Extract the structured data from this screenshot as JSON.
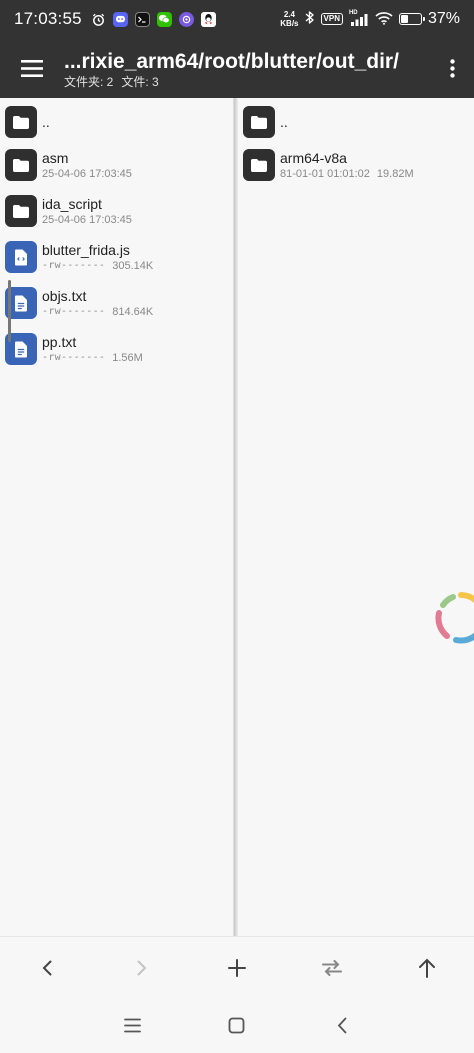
{
  "status_bar": {
    "time": "17:03:55",
    "notification_icons": [
      "alarm-icon",
      "discord-icon",
      "terminal-icon",
      "wechat-icon",
      "mastodon-icon",
      "qq-icon"
    ],
    "net_speed_value": "2.4",
    "net_speed_unit": "KB/s",
    "vpn_label": "VPN",
    "hd_label": "HD",
    "battery_percent_label": "37%",
    "battery_level": 0.37
  },
  "toolbar": {
    "path_title": "...rixie_arm64/root/blutter/out_dir/",
    "folder_count_label": "文件夹: 2",
    "file_count_label": "文件: 3"
  },
  "left_pane": {
    "parent_label": "..",
    "items": [
      {
        "type": "folder",
        "name": "asm",
        "perm": "",
        "size": "",
        "date": "25-04-06 17:03:45"
      },
      {
        "type": "folder",
        "name": "ida_script",
        "perm": "",
        "size": "",
        "date": "25-04-06 17:03:45"
      },
      {
        "type": "code-file",
        "name": "blutter_frida.js",
        "perm": "-rw-------",
        "size": "305.14K",
        "date": ""
      },
      {
        "type": "text-file",
        "name": "objs.txt",
        "perm": "-rw-------",
        "size": "814.64K",
        "date": ""
      },
      {
        "type": "text-file",
        "name": "pp.txt",
        "perm": "-rw-------",
        "size": "1.56M",
        "date": ""
      }
    ]
  },
  "right_pane": {
    "parent_label": "..",
    "items": [
      {
        "type": "folder",
        "name": "arm64-v8a",
        "date": "81-01-01 01:01:02",
        "size": "19.82M"
      }
    ]
  },
  "bottom_actions": [
    "back-icon",
    "forward-icon",
    "add-icon",
    "swap-icon",
    "up-icon"
  ],
  "nav_bar": [
    "menu-icon",
    "home-icon",
    "back-icon"
  ],
  "colors": {
    "bar_bg": "#333333",
    "folder_icon_bg": "#2f2f2f",
    "file_icon_bg": "#3a64b5",
    "pane_bg": "#f7f7f7"
  }
}
